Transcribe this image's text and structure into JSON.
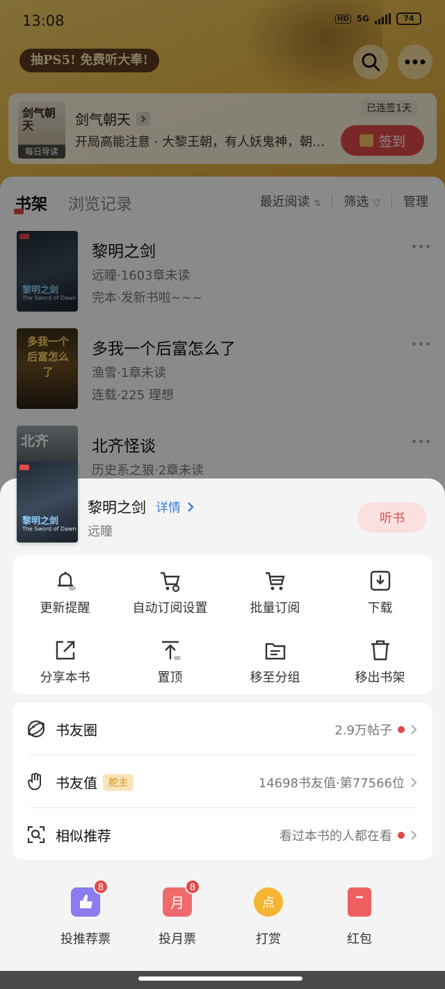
{
  "status_bar": {
    "time": "13:08",
    "network": "5G",
    "battery": "74",
    "hd": "HD"
  },
  "header": {
    "promo": "抽PS5! 免费听大奉!"
  },
  "daily": {
    "cover_title": "剑气朝天",
    "cover_tag": "每日导读",
    "title": "剑气朝天",
    "desc": "开局高能注意 · 大黎王朝，有人妖鬼神，朝…",
    "streak": "已连签1天",
    "signin": "签到"
  },
  "shelf": {
    "tab_active": "书架",
    "tab_inactive": "浏览记录",
    "tools": {
      "recent": "最近阅读",
      "filter": "筛选",
      "manage": "管理"
    },
    "books": [
      {
        "title": "黎明之剑",
        "meta": "远瞳·1603章未读",
        "status": "完本·发新书啦~~~",
        "cover_text": "黎明之剑",
        "cover_sub": "The Sword of Dawn"
      },
      {
        "title": "多我一个后富怎么了",
        "meta": "渔雪·1章未读",
        "status": "连载·225 理想",
        "cover_text": "多我一个后富怎么了"
      },
      {
        "title": "北齐怪谈",
        "meta": "历史系之狼·2章未读",
        "status": "",
        "cover_text": "北齐"
      }
    ]
  },
  "sheet": {
    "title": "黎明之剑",
    "detail": "详情",
    "author": "远瞳",
    "listen": "听书",
    "actions": [
      {
        "label": "更新提醒",
        "icon": "bell-icon"
      },
      {
        "label": "自动订阅设置",
        "icon": "cart-settings-icon"
      },
      {
        "label": "批量订阅",
        "icon": "cart-icon"
      },
      {
        "label": "下载",
        "icon": "download-icon"
      },
      {
        "label": "分享本书",
        "icon": "share-icon"
      },
      {
        "label": "置顶",
        "icon": "pin-top-icon"
      },
      {
        "label": "移至分组",
        "icon": "folder-icon"
      },
      {
        "label": "移出书架",
        "icon": "trash-icon"
      }
    ],
    "list": [
      {
        "label": "书友圈",
        "value": "2.9万帖子",
        "dot": true
      },
      {
        "label": "书友值",
        "badge": "舵主",
        "value": "14698书友值·第77566位",
        "dot": false
      },
      {
        "label": "相似推荐",
        "value": "看过本书的人都在看",
        "dot": true
      }
    ],
    "rewards": [
      {
        "label": "投推荐票",
        "count": "8",
        "color": "#8b7cf0"
      },
      {
        "label": "投月票",
        "count": "8",
        "color": "#ef6b6b"
      },
      {
        "label": "打赏",
        "count": "",
        "color": "#f5b533"
      },
      {
        "label": "红包",
        "count": "",
        "color": "#ef5f5f"
      }
    ]
  }
}
